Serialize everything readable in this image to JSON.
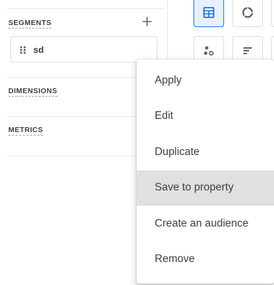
{
  "variables_panel": {
    "segments_label": "SEGMENTS",
    "add_segment_symbol": "+",
    "segment_items": [
      {
        "name": "sd"
      }
    ],
    "dimensions_label": "DIMENSIONS",
    "metrics_label": "METRICS"
  },
  "visualizations": [
    {
      "icon": "table-icon",
      "selected": true
    },
    {
      "icon": "donut-chart-icon",
      "selected": false
    },
    {
      "icon": "scatter-plot-icon",
      "selected": false
    },
    {
      "icon": "bar-chart-icon",
      "selected": false
    }
  ],
  "context_menu": {
    "items": [
      {
        "label": "Apply"
      },
      {
        "label": "Edit"
      },
      {
        "label": "Duplicate"
      },
      {
        "label": "Save to property",
        "highlighted": true
      },
      {
        "label": "Create an audience"
      },
      {
        "label": "Remove"
      }
    ]
  },
  "colors": {
    "accent": "#1a73e8",
    "selected_background": "#e8f0fe",
    "highlight": "#e0e0e0",
    "text": "#3c4043",
    "divider": "#e8eaed"
  }
}
